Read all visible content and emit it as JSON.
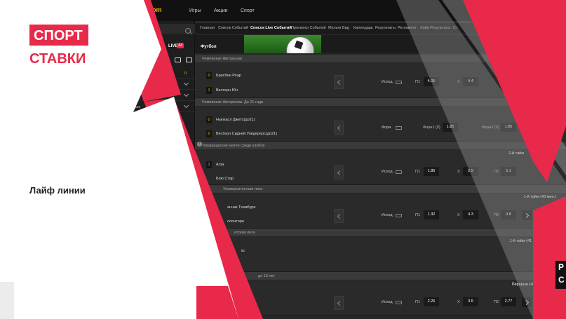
{
  "brand": {
    "line1": "СПОРТ",
    "line2": "СТАВКИ",
    "accent": "#e8294a"
  },
  "caption": "Лайф линии",
  "side_badge": {
    "line1": "Р",
    "line2": "С"
  },
  "site": {
    "logo": "Boom",
    "top_nav": [
      "Игры",
      "Акции",
      "Спорт"
    ],
    "sub_nav": [
      "Главная",
      "Список Событий",
      "Список Live Событий",
      "Просмотр Событий",
      "Мульти Вид",
      "Календарь",
      "Результаты",
      "Регламент",
      "Лайв Результаты",
      "Ст"
    ],
    "sub_nav_active": 2,
    "sidebar": {
      "live_label": "LIVE",
      "live_count": "44",
      "rows": [
        {
          "label": "лы",
          "count": "0"
        },
        {
          "label": "бол (9)",
          "count": ""
        },
        {
          "label": "Хоккей (2)",
          "count": ""
        },
        {
          "label": "Баск",
          "count": ""
        }
      ]
    },
    "section_title": "Футбол",
    "leagues": [
      {
        "name": "Чемпионат Австралии",
        "status": ""
      },
      {
        "name": "Чемпионат Австралии. До 21 года",
        "status": ""
      },
      {
        "name": "Товарищеские матчи среди клубов",
        "status": "2-й тайм"
      },
      {
        "name": "Университетская лига",
        "status": "1-й тайм (43 мин.)"
      },
      {
        "name": "етская лига",
        "status": "1-й тайм (41 мин.)"
      },
      {
        "name": "до 19 лет",
        "status": "Перерыв (46 мин.)"
      }
    ],
    "matches": [
      {
        "teams": [
          "Брисбен Роар",
          "Вестерн Юн"
        ],
        "scores": [
          "0",
          "1"
        ],
        "market": "Исход",
        "odds": [
          {
            "label": "П1",
            "value": "4.05"
          },
          {
            "label": "Х",
            "value": "4.4"
          }
        ],
        "more": ""
      },
      {
        "teams": [
          "Ньюкасл Джетс(до21)",
          "Вестерн Сидней Уондерерс(до21)"
        ],
        "scores": [
          "0",
          "0"
        ],
        "market": "Фора",
        "odds": [
          {
            "label": "Фора1 (0)",
            "value": "1.85"
          },
          {
            "label": "Фора2 (0)",
            "value": "1.85"
          }
        ],
        "more": ""
      },
      {
        "teams": [
          "Агза",
          "Блю Стар"
        ],
        "scores": [
          "1",
          ""
        ],
        "market": "Исход",
        "odds": [
          {
            "label": "П1",
            "value": "1.85"
          },
          {
            "label": "Х",
            "value": "2.9"
          },
          {
            "label": "П2",
            "value": "5.1"
          }
        ],
        "more": ""
      },
      {
        "teams": [
          "анчак Тхамбури",
          "олонторн"
        ],
        "scores": [
          "",
          ""
        ],
        "market": "Исход",
        "odds": [
          {
            "label": "П1",
            "value": "1.32"
          },
          {
            "label": "Х",
            "value": "4.3"
          },
          {
            "label": "П2",
            "value": "9.8"
          }
        ],
        "more": "+106"
      },
      {
        "teams": [
          "кс",
          ""
        ],
        "scores": [
          "",
          ""
        ],
        "market": "",
        "odds": [],
        "more": "0"
      },
      {
        "teams": [
          "",
          ""
        ],
        "scores": [
          "",
          ""
        ],
        "market": "Исход",
        "odds": [
          {
            "label": "П1",
            "value": "2.26"
          },
          {
            "label": "Х",
            "value": "3.5"
          },
          {
            "label": "П2",
            "value": "2.77"
          }
        ],
        "more": "+161"
      }
    ]
  }
}
